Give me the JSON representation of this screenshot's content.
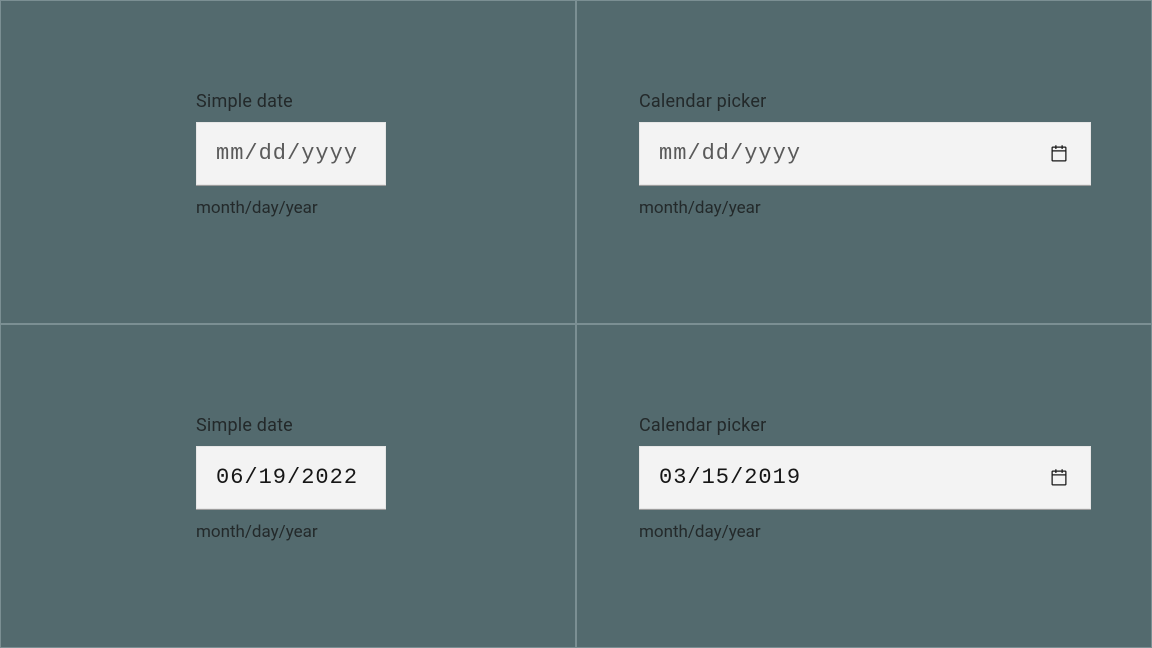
{
  "cells": [
    {
      "label": "Simple date",
      "placeholder": "mm/dd/yyyy",
      "value": "",
      "helper": "month/day/year",
      "picker": false
    },
    {
      "label": "Calendar picker",
      "placeholder": "mm/dd/yyyy",
      "value": "",
      "helper": "month/day/year",
      "picker": true
    },
    {
      "label": "Simple date",
      "placeholder": "mm/dd/yyyy",
      "value": "06/19/2022",
      "helper": "month/day/year",
      "picker": false
    },
    {
      "label": "Calendar picker",
      "placeholder": "mm/dd/yyyy",
      "value": "03/15/2019",
      "helper": "month/day/year",
      "picker": true
    }
  ]
}
